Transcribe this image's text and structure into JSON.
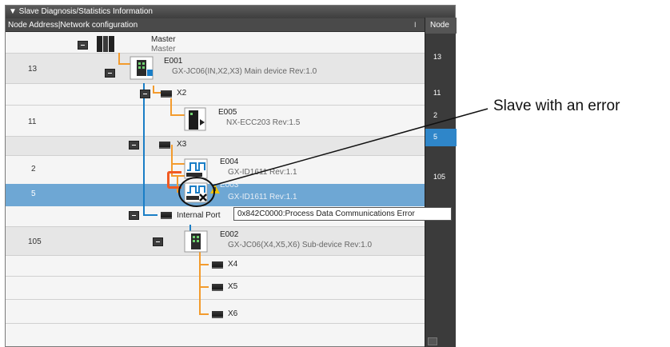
{
  "panel": {
    "title": "▼ Slave Diagnosis/Statistics Information",
    "column_header": "Node Address|Network configuration",
    "column_sep": "I"
  },
  "rows": {
    "master": {
      "name": "Master",
      "sub": "Master"
    },
    "e001": {
      "addr": "13",
      "name": "E001",
      "desc": "GX-JC06(IN,X2,X3) Main device Rev:1.0"
    },
    "x2": {
      "label": "X2"
    },
    "e005": {
      "addr": "11",
      "name": "E005",
      "desc": "NX-ECC203 Rev:1.5"
    },
    "x3": {
      "label": "X3"
    },
    "e004": {
      "addr": "2",
      "name": "E004",
      "desc": "GX-ID1611 Rev:1.1"
    },
    "e003": {
      "addr": "5",
      "name": "E003",
      "desc": "GX-ID1611 Rev:1.1"
    },
    "internal": {
      "label": "Internal Port"
    },
    "e002": {
      "addr": "105",
      "name": "E002",
      "desc": "GX-JC06(X4,X5,X6) Sub-device Rev:1.0"
    },
    "x4": {
      "label": "X4"
    },
    "x5": {
      "label": "X5"
    },
    "x6": {
      "label": "X6"
    }
  },
  "right_panel": {
    "header": "Node",
    "cells": [
      "13",
      "11",
      "2",
      "5",
      "105"
    ]
  },
  "tooltip": "0x842C0000:Process Data Communications Error",
  "callout": "Slave with an error",
  "colors": {
    "selected_row": "#6ea7d4",
    "orange_line": "#f39b2d",
    "blue_line": "#1a7ec6",
    "error_warning": "#f2c200"
  }
}
